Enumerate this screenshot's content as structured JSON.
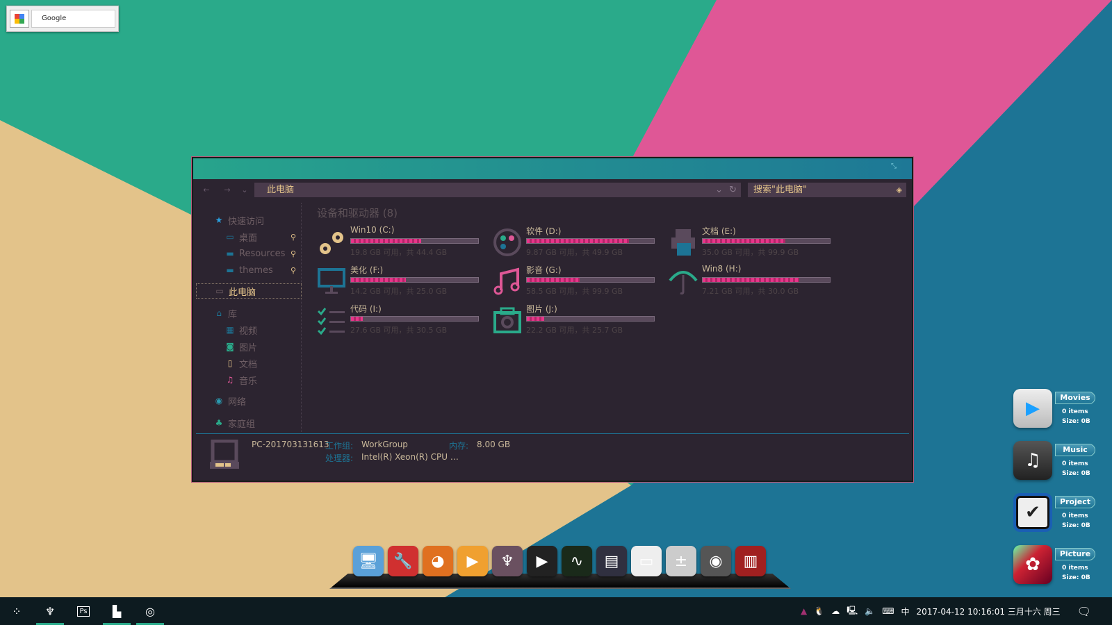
{
  "colors": {
    "teal": "#2aaa8a",
    "pink": "#df5796",
    "blue": "#1d7495",
    "tan": "#e3c38a",
    "accent": "#e8358a"
  },
  "google_widget": {
    "label": "Google"
  },
  "explorer": {
    "address": "此电脑",
    "search_placeholder": "搜索\"此电脑\"",
    "nav": {
      "back": "←",
      "forward": "→",
      "recent": "⌄",
      "dropdown": "⌄",
      "refresh": "↻"
    },
    "sidebar": [
      {
        "label": "快速访问",
        "icon": "star-icon",
        "pinned": false
      },
      {
        "label": "桌面",
        "icon": "desktop-icon",
        "pinned": true
      },
      {
        "label": "Resources",
        "icon": "folder-icon",
        "pinned": true
      },
      {
        "label": "themes",
        "icon": "folder-icon",
        "pinned": true
      },
      {
        "label": "此电脑",
        "icon": "computer-icon",
        "pinned": false
      },
      {
        "label": "库",
        "icon": "library-icon",
        "pinned": false
      },
      {
        "label": "视频",
        "icon": "video-icon",
        "pinned": false
      },
      {
        "label": "图片",
        "icon": "camera-icon",
        "pinned": false
      },
      {
        "label": "文档",
        "icon": "document-icon",
        "pinned": false
      },
      {
        "label": "音乐",
        "icon": "music-icon",
        "pinned": false
      },
      {
        "label": "网络",
        "icon": "globe-icon",
        "pinned": false
      },
      {
        "label": "家庭组",
        "icon": "homegroup-icon",
        "pinned": false
      }
    ],
    "section_title": "设备和驱动器 (8)",
    "drives": [
      {
        "name": "Win10 (C:)",
        "free": 19.8,
        "total": 44.4,
        "size_text": "19.8 GB 可用，共 44.4 GB",
        "icon": "gears-icon"
      },
      {
        "name": "软件 (D:)",
        "free": 9.87,
        "total": 49.9,
        "size_text": "9.87 GB 可用，共 49.9 GB",
        "icon": "palette-icon"
      },
      {
        "name": "文档 (E:)",
        "free": 35.0,
        "total": 99.9,
        "size_text": "35.0 GB 可用，共 99.9 GB",
        "icon": "printer-icon"
      },
      {
        "name": "美化 (F:)",
        "free": 14.2,
        "total": 25.0,
        "size_text": "14.2 GB 可用，共 25.0 GB",
        "icon": "monitor-icon"
      },
      {
        "name": "影音 (G:)",
        "free": 58.5,
        "total": 99.9,
        "size_text": "58.5 GB 可用，共 99.9 GB",
        "icon": "music-icon"
      },
      {
        "name": "Win8 (H:)",
        "free": 7.21,
        "total": 30.0,
        "size_text": "7.21 GB 可用，共 30.0 GB",
        "icon": "umbrella-icon"
      },
      {
        "name": "代码 (I:)",
        "free": 27.6,
        "total": 30.5,
        "size_text": "27.6 GB 可用，共 30.5 GB",
        "icon": "checklist-icon"
      },
      {
        "name": "图片 (J:)",
        "free": 22.2,
        "total": 25.7,
        "size_text": "22.2 GB 可用，共 25.7 GB",
        "icon": "camera-icon"
      }
    ],
    "details": {
      "pc_name": "PC-201703131613",
      "workgroup_label": "工作组:",
      "workgroup": "WorkGroup",
      "memory_label": "内存:",
      "memory": "8.00 GB",
      "cpu_label": "处理器:",
      "cpu": "Intel(R) Xeon(R) CPU …"
    }
  },
  "libraries": [
    {
      "name": "Movies",
      "items": "0 items",
      "size": "Size: 0B"
    },
    {
      "name": "Music",
      "items": "0 items",
      "size": "Size: 0B"
    },
    {
      "name": "Project",
      "items": "0 items",
      "size": "Size: 0B"
    },
    {
      "name": "Picture",
      "items": "0 items",
      "size": "Size: 0B"
    }
  ],
  "dock": [
    "my-computer",
    "tools",
    "firefox",
    "media-player",
    "foobar",
    "play",
    "system-monitor",
    "total-commander",
    "notes",
    "calculator",
    "camera",
    "trash"
  ],
  "taskbar": {
    "ime": "中",
    "date": "2017-04-12",
    "time": "10:16:01",
    "lunar": "三月十六 周三",
    "ps_label": "Ps"
  }
}
